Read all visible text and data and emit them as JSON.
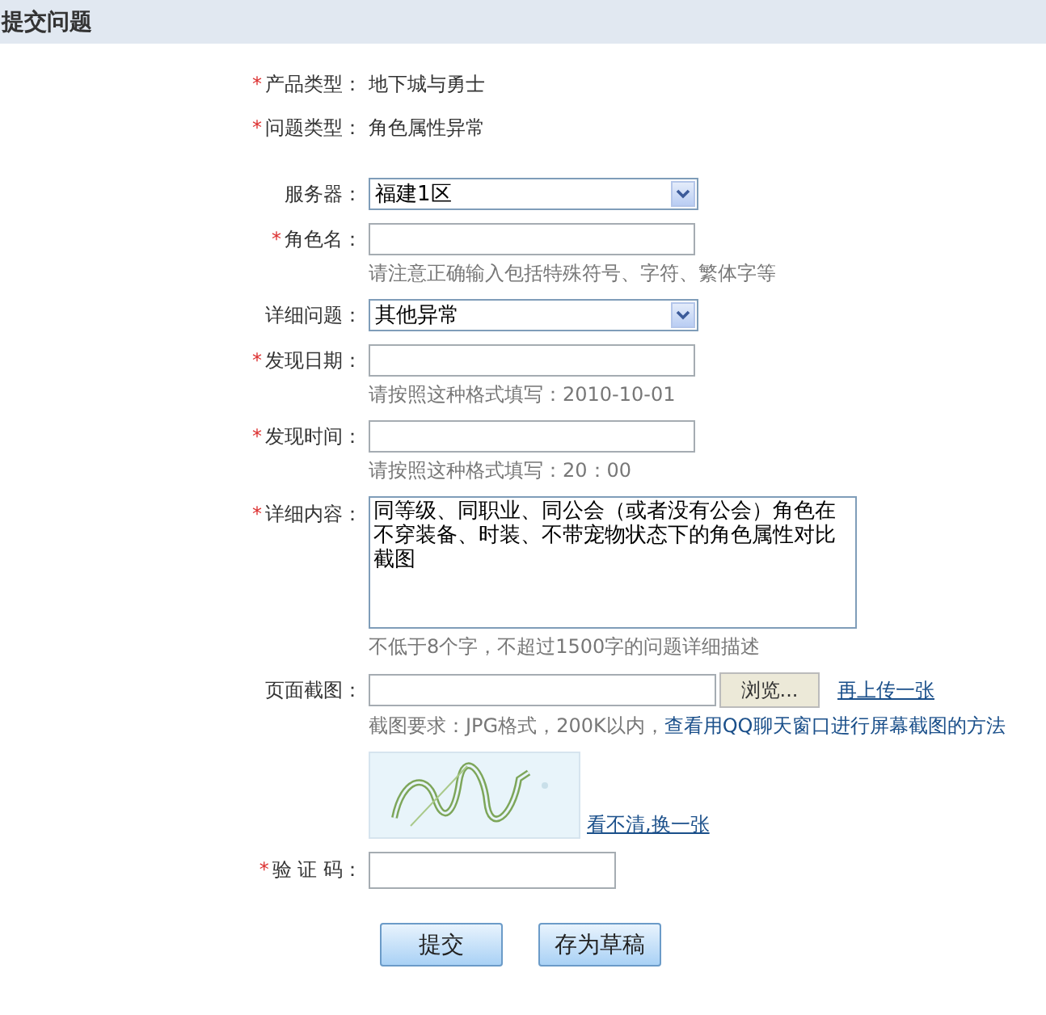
{
  "header": {
    "title": "提交问题"
  },
  "info": [
    {
      "label": "产品类型：",
      "mark": "*",
      "value": "地下城与勇士"
    },
    {
      "label": "问题类型：",
      "mark": "*",
      "value": "角色属性异常"
    }
  ],
  "fields": [
    {
      "kind": "select",
      "label": "服务器：",
      "value": "福建1区"
    },
    {
      "kind": "text",
      "label": "角色名：",
      "mark": "*",
      "hint": "请注意正确输入包括特殊符号、字符、繁体字等"
    },
    {
      "kind": "select",
      "label": "详细问题：",
      "value": "其他异常"
    },
    {
      "kind": "text",
      "label": "发现日期：",
      "mark": "*",
      "hint": "请按照这种格式填写：2010-10-01"
    },
    {
      "kind": "text",
      "label": "发现时间：",
      "mark": "*",
      "hint": "请按照这种格式填写：20：00"
    },
    {
      "kind": "textarea",
      "label": "详细内容：",
      "mark": "*",
      "value": "同等级、同职业、同公会（或者没有公会）角色在不穿装备、时装、不带宠物状态下的角色属性对比截图",
      "hint": "不低于8个字，不超过1500字的问题详细描述"
    },
    {
      "kind": "file",
      "label": "页面截图：",
      "button": "浏览...",
      "link": "再上传一张",
      "hint": "截图要求：JPG格式，200K以内，",
      "hint_link": "查看用QQ聊天窗口进行屏幕截图的方法"
    },
    {
      "kind": "captcha",
      "link": "看不清,换一张"
    },
    {
      "kind": "short",
      "label": "验 证 码：",
      "mark": "*"
    }
  ],
  "buttons": [
    "提交",
    "存为草稿"
  ]
}
